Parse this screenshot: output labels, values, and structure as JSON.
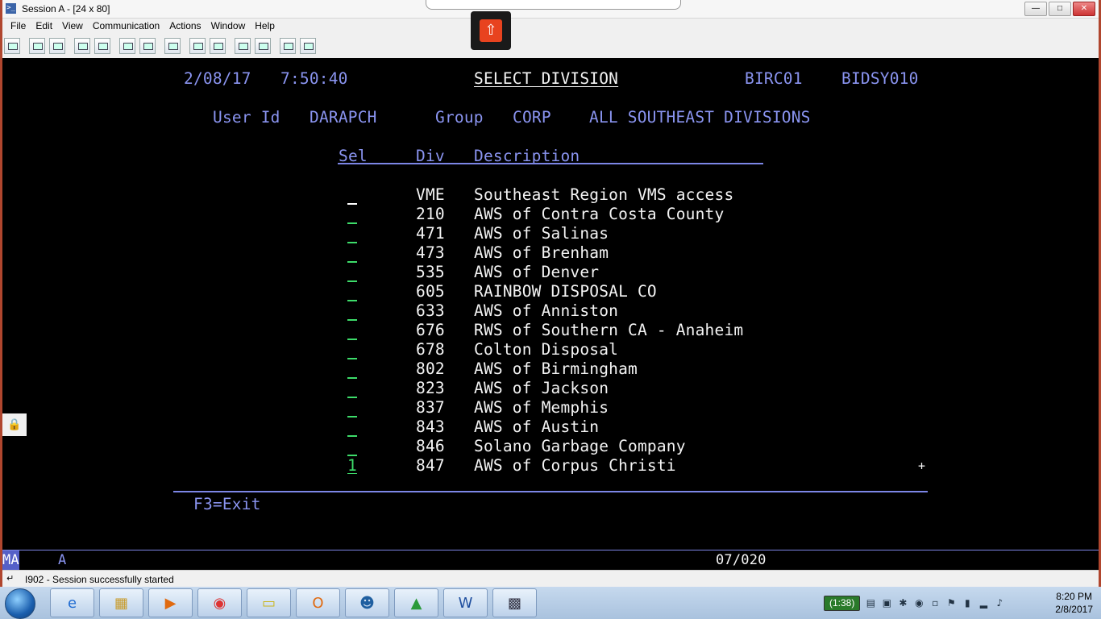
{
  "window": {
    "title": "Session A - [24 x 80]"
  },
  "menu": [
    "File",
    "Edit",
    "View",
    "Communication",
    "Actions",
    "Window",
    "Help"
  ],
  "screen": {
    "date": "2/08/17",
    "time": "7:50:40",
    "title": "SELECT DIVISION",
    "program": "BIRC01",
    "screen_id": "BIDSY010",
    "user_label": "User Id",
    "user_value": "DARAPCH",
    "group_label": "Group",
    "group_value": "CORP",
    "group_desc": "ALL SOUTHEAST DIVISIONS",
    "col_sel": "Sel",
    "col_div": "Div",
    "col_desc": "Description",
    "rows": [
      {
        "sel": "",
        "div": "VME",
        "desc": "Southeast Region VMS access"
      },
      {
        "sel": "",
        "div": "210",
        "desc": "AWS of Contra Costa County"
      },
      {
        "sel": "",
        "div": "471",
        "desc": "AWS of Salinas"
      },
      {
        "sel": "",
        "div": "473",
        "desc": "AWS of Brenham"
      },
      {
        "sel": "",
        "div": "535",
        "desc": "AWS of Denver"
      },
      {
        "sel": "",
        "div": "605",
        "desc": "RAINBOW DISPOSAL CO"
      },
      {
        "sel": "",
        "div": "633",
        "desc": "AWS of Anniston"
      },
      {
        "sel": "",
        "div": "676",
        "desc": "RWS of Southern CA - Anaheim"
      },
      {
        "sel": "",
        "div": "678",
        "desc": "Colton Disposal"
      },
      {
        "sel": "",
        "div": "802",
        "desc": "AWS of Birmingham"
      },
      {
        "sel": "",
        "div": "823",
        "desc": "AWS of Jackson"
      },
      {
        "sel": "",
        "div": "837",
        "desc": "AWS of Memphis"
      },
      {
        "sel": "",
        "div": "843",
        "desc": "AWS of Austin"
      },
      {
        "sel": "",
        "div": "846",
        "desc": "Solano Garbage Company"
      },
      {
        "sel": "1",
        "div": "847",
        "desc": "AWS of Corpus Christi"
      }
    ],
    "more_indicator": "+",
    "fkey": "F3=Exit",
    "oia_left": "MA",
    "oia_mode": "A",
    "cursor_pos": "07/020"
  },
  "status": {
    "message": "I902 - Session successfully started"
  },
  "taskbar": {
    "battery": "(1:38)",
    "time": "8:20 PM",
    "date": "2/8/2017"
  }
}
